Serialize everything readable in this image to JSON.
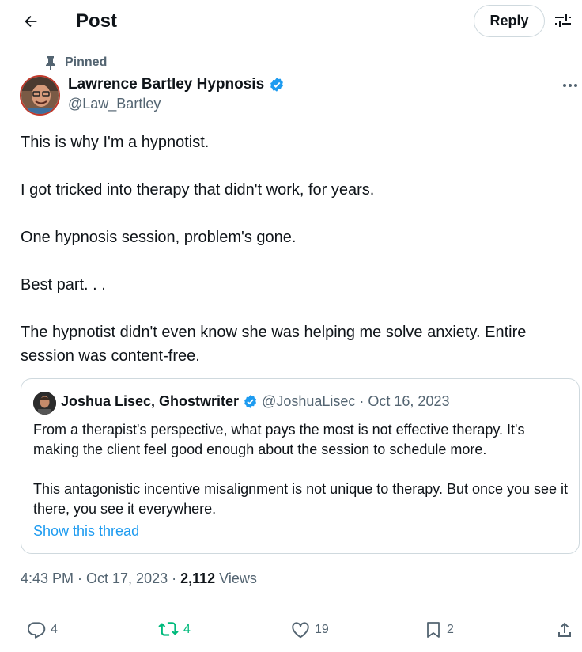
{
  "header": {
    "title": "Post",
    "reply_label": "Reply"
  },
  "post": {
    "pinned_label": "Pinned",
    "author_name": "Lawrence Bartley Hypnosis",
    "author_handle": "@Law_Bartley",
    "verified": true,
    "paragraphs": [
      "This is why I'm a hypnotist.",
      "I got tricked into therapy that didn't work, for years.",
      "One hypnosis session, problem's gone.",
      "Best part. . .",
      "The hypnotist didn't even know she was helping me solve anxiety. Entire session was content-free."
    ]
  },
  "quote": {
    "author_name": "Joshua Lisec, Ghostwriter",
    "author_handle": "@JoshuaLisec",
    "separator": "·",
    "date": "Oct 16, 2023",
    "paragraphs": [
      "From a therapist's perspective, what pays the most is not effective therapy. It's making the client feel good enough about the session to schedule more.",
      "This antagonistic incentive misalignment is not unique to therapy. But once you see it there, you see it everywhere."
    ],
    "show_thread_label": "Show this thread"
  },
  "meta": {
    "time_date": "4:43 PM · Oct 17, 2023 ·",
    "views_count": "2,112",
    "views_label": "Views"
  },
  "actions": {
    "replies": "4",
    "reposts": "4",
    "likes": "19",
    "bookmarks": "2"
  },
  "colors": {
    "accent": "#1d9bf0",
    "repost_active": "#00ba7c",
    "muted_text": "#536471",
    "border": "#cfd9de"
  },
  "icons": [
    "back-arrow-icon",
    "tune-icon",
    "pin-icon",
    "verified-badge-icon",
    "more-icon",
    "reply-icon",
    "repost-icon",
    "like-icon",
    "bookmark-icon",
    "share-icon"
  ]
}
